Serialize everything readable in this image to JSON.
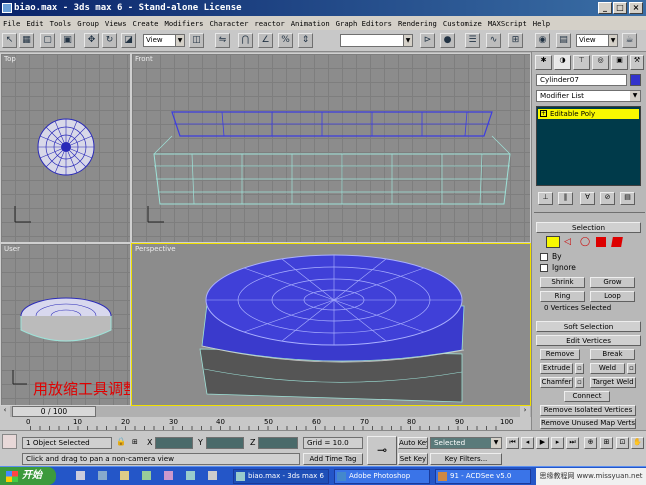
{
  "title_bar": {
    "title": "biao.max - 3ds max 6 - Stand-alone License",
    "buttons": [
      "_",
      "□",
      "×"
    ]
  },
  "menu": [
    "File",
    "Edit",
    "Tools",
    "Group",
    "Views",
    "Create",
    "Modifiers",
    "Character",
    "reactor",
    "Animation",
    "Graph Editors",
    "Rendering",
    "Customize",
    "MAXScript",
    "Help"
  ],
  "toolbar": {
    "ref_coord": "View",
    "view_dropdown": "View",
    "selection_set": ""
  },
  "viewports": {
    "top": "Top",
    "front": "Front",
    "user": "User",
    "perspective": "Perspective"
  },
  "annotation": "用放缩工具调整点",
  "command_panel": {
    "object_name": "Cylinder07",
    "modifier_list": "Modifier List",
    "stack_item": "Editable Poly",
    "selection_title": "Selection",
    "by_label": "By",
    "ignore_label": "Ignore",
    "shrink": "Shrink",
    "grow": "Grow",
    "ring": "Ring",
    "loop": "Loop",
    "vertices_selected": "0 Vertices Selected",
    "soft_selection": "Soft Selection",
    "edit_vertices": "Edit Vertices",
    "remove": "Remove",
    "break": "Break",
    "extrude": "Extrude",
    "weld": "Weld",
    "chamfer": "Chamfer",
    "target_weld": "Target Weld",
    "connect": "Connect",
    "remove_isolated": "Remove Isolated Vertices",
    "remove_unused": "Remove Unused Map Verts"
  },
  "timeline": {
    "frame": "0 / 100",
    "ticks": [
      "0",
      "10",
      "20",
      "30",
      "40",
      "50",
      "60",
      "70",
      "80",
      "90",
      "100"
    ]
  },
  "status": {
    "selection": "1 Object Selected",
    "prompt": "Click and drag to pan a non-camera view",
    "x_label": "X",
    "y_label": "Y",
    "z_label": "Z",
    "grid": "Grid = 10.0",
    "add_time_tag": "Add Time Tag",
    "auto_key": "Auto Key",
    "set_key": "Set Key",
    "selected_dropdown": "Selected",
    "key_filters": "Key Filters..."
  },
  "taskbar": {
    "start": "开始",
    "tasks": [
      "biao.max - 3ds max 6",
      "Adobe Photoshop",
      "91 - ACDSee v5.0"
    ],
    "watermark": "思缘教程网 www.missyuan.net"
  },
  "colors": {
    "accent_blue": "#3333cc",
    "annotation_red": "#e00000",
    "selection_yellow": "#f8f800",
    "stack_bg": "#003a4a"
  }
}
